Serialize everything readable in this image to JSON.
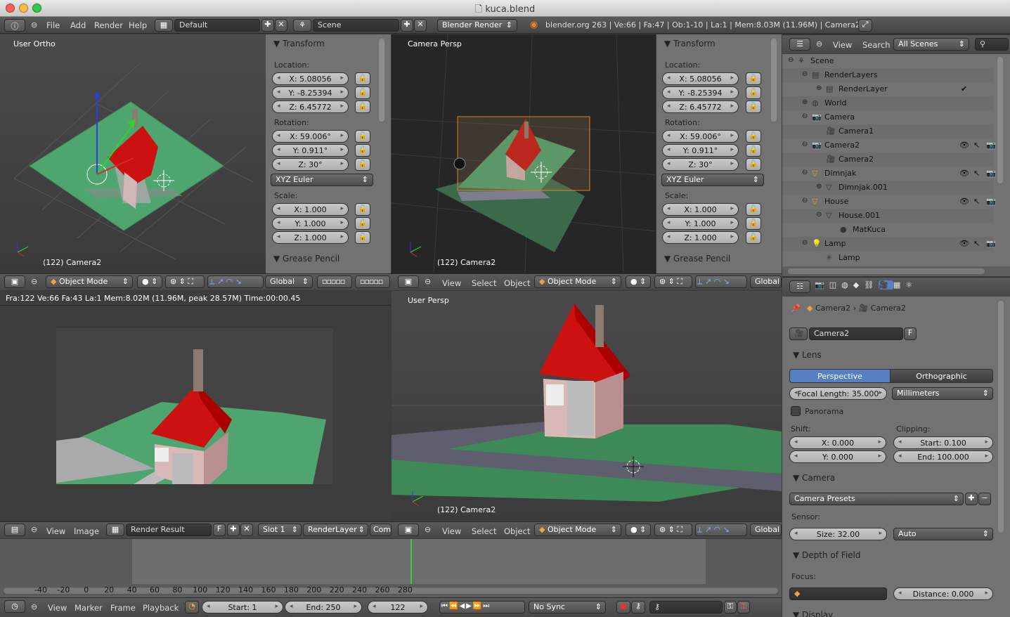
{
  "window": {
    "title": "kuca.blend"
  },
  "topbar": {
    "menus": [
      "File",
      "Add",
      "Render",
      "Help"
    ],
    "screen": "Default",
    "scene": "Scene",
    "engine": "Blender Render",
    "info": "blender.org 263 | Ve:66 | Fa:47 | Ob:1-10 | La:1 | Mem:8.03M (11.96M) | Camera2"
  },
  "viewport_tl": {
    "label": "User Ortho",
    "object": "(122) Camera2"
  },
  "viewport_tr": {
    "label": "Camera Persp",
    "object": "(122) Camera2"
  },
  "viewport_br": {
    "label": "User Persp",
    "object": "(122) Camera2"
  },
  "transform": {
    "title": "Transform",
    "location_label": "Location:",
    "location": [
      "X: 5.08056",
      "Y: -8.25394",
      "Z: 6.45772"
    ],
    "rotation_label": "Rotation:",
    "rotation": [
      "X: 59.006°",
      "Y: 0.911°",
      "Z: 30°"
    ],
    "rotation_mode": "XYZ Euler",
    "scale_label": "Scale:",
    "scale": [
      "X: 1.000",
      "Y: 1.000",
      "Z: 1.000"
    ],
    "grease_pencil": "Grease Pencil"
  },
  "view3d_header": {
    "view": "View",
    "select": "Select",
    "object": "Object",
    "mode": "Object Mode",
    "orientation": "Global"
  },
  "image_editor": {
    "status": "Fra:122  Ve:66 Fa:43 La:1 Mem:8.02M (11.96M, peak 28.57M) Time:00:00.45",
    "view": "View",
    "image": "Image",
    "render_result": "Render Result",
    "f": "F",
    "slot": "Slot 1",
    "layer": "RenderLayer",
    "comp": "Comb"
  },
  "outliner": {
    "view": "View",
    "search": "Search",
    "filter": "All Scenes",
    "rows": [
      {
        "label": "Scene"
      },
      {
        "label": "RenderLayers"
      },
      {
        "label": "RenderLayer"
      },
      {
        "label": "World"
      },
      {
        "label": "Camera"
      },
      {
        "label": "Camera1"
      },
      {
        "label": "Camera2"
      },
      {
        "label": "Camera2"
      },
      {
        "label": "Dimnjak"
      },
      {
        "label": "Dimnjak.001"
      },
      {
        "label": "House"
      },
      {
        "label": "House.001"
      },
      {
        "label": "MatKuca"
      },
      {
        "label": "Lamp"
      },
      {
        "label": "Lamp"
      }
    ]
  },
  "properties": {
    "breadcrumb": [
      "Camera2",
      "Camera2"
    ],
    "datablock": "Camera2",
    "f": "F",
    "lens": {
      "title": "Lens",
      "perspective": "Perspective",
      "orthographic": "Orthographic",
      "focal": "Focal Length: 35.000",
      "unit": "Millimeters",
      "panorama": "Panorama",
      "shift_label": "Shift:",
      "shift_x": "X: 0.000",
      "shift_y": "Y: 0.000",
      "clipping_label": "Clipping:",
      "clip_start": "Start: 0.100",
      "clip_end": "End: 100.000"
    },
    "camera": {
      "title": "Camera",
      "presets": "Camera Presets",
      "sensor_label": "Sensor:",
      "size": "Size: 32.00",
      "fit": "Auto"
    },
    "dof": {
      "title": "Depth of Field",
      "focus_label": "Focus:",
      "distance": "Distance: 0.000",
      "display": "Display"
    }
  },
  "timeline": {
    "ticks": [
      "-40",
      "-20",
      "0",
      "20",
      "40",
      "60",
      "80",
      "100",
      "120",
      "140",
      "160",
      "180",
      "200",
      "220",
      "240",
      "260",
      "280"
    ],
    "view": "View",
    "marker": "Marker",
    "frame": "Frame",
    "playback": "Playback",
    "start": "Start: 1",
    "end": "End: 250",
    "current": "122",
    "sync": "No Sync"
  },
  "colors": {
    "accent": "#5680c2",
    "grass": "#4fa56f",
    "roof": "#cc1111",
    "cursor_line": "#3ec93e"
  }
}
